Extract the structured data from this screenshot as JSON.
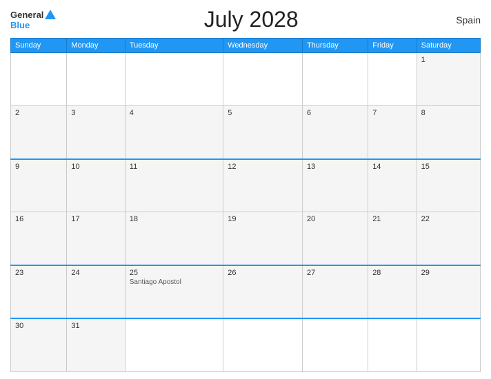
{
  "logo": {
    "general": "General",
    "blue": "Blue"
  },
  "header": {
    "title": "July 2028",
    "country": "Spain"
  },
  "weekdays": [
    "Sunday",
    "Monday",
    "Tuesday",
    "Wednesday",
    "Thursday",
    "Friday",
    "Saturday"
  ],
  "weeks": [
    [
      {
        "day": "",
        "empty": true
      },
      {
        "day": "",
        "empty": true
      },
      {
        "day": "",
        "empty": true
      },
      {
        "day": "",
        "empty": true
      },
      {
        "day": "",
        "empty": true
      },
      {
        "day": "",
        "empty": true
      },
      {
        "day": "1",
        "empty": false,
        "event": ""
      }
    ],
    [
      {
        "day": "2",
        "empty": false,
        "event": ""
      },
      {
        "day": "3",
        "empty": false,
        "event": ""
      },
      {
        "day": "4",
        "empty": false,
        "event": ""
      },
      {
        "day": "5",
        "empty": false,
        "event": ""
      },
      {
        "day": "6",
        "empty": false,
        "event": ""
      },
      {
        "day": "7",
        "empty": false,
        "event": ""
      },
      {
        "day": "8",
        "empty": false,
        "event": ""
      }
    ],
    [
      {
        "day": "9",
        "empty": false,
        "event": ""
      },
      {
        "day": "10",
        "empty": false,
        "event": ""
      },
      {
        "day": "11",
        "empty": false,
        "event": ""
      },
      {
        "day": "12",
        "empty": false,
        "event": ""
      },
      {
        "day": "13",
        "empty": false,
        "event": ""
      },
      {
        "day": "14",
        "empty": false,
        "event": ""
      },
      {
        "day": "15",
        "empty": false,
        "event": ""
      }
    ],
    [
      {
        "day": "16",
        "empty": false,
        "event": ""
      },
      {
        "day": "17",
        "empty": false,
        "event": ""
      },
      {
        "day": "18",
        "empty": false,
        "event": ""
      },
      {
        "day": "19",
        "empty": false,
        "event": ""
      },
      {
        "day": "20",
        "empty": false,
        "event": ""
      },
      {
        "day": "21",
        "empty": false,
        "event": ""
      },
      {
        "day": "22",
        "empty": false,
        "event": ""
      }
    ],
    [
      {
        "day": "23",
        "empty": false,
        "event": ""
      },
      {
        "day": "24",
        "empty": false,
        "event": ""
      },
      {
        "day": "25",
        "empty": false,
        "event": "Santiago Apostol"
      },
      {
        "day": "26",
        "empty": false,
        "event": ""
      },
      {
        "day": "27",
        "empty": false,
        "event": ""
      },
      {
        "day": "28",
        "empty": false,
        "event": ""
      },
      {
        "day": "29",
        "empty": false,
        "event": ""
      }
    ],
    [
      {
        "day": "30",
        "empty": false,
        "event": ""
      },
      {
        "day": "31",
        "empty": false,
        "event": ""
      },
      {
        "day": "",
        "empty": true
      },
      {
        "day": "",
        "empty": true
      },
      {
        "day": "",
        "empty": true
      },
      {
        "day": "",
        "empty": true
      },
      {
        "day": "",
        "empty": true
      }
    ]
  ],
  "blueTopRows": [
    2,
    4,
    5
  ],
  "colors": {
    "header_bg": "#2196f3",
    "cell_bg": "#f5f5f5",
    "empty_bg": "#ffffff",
    "blue_border": "#2196f3"
  }
}
